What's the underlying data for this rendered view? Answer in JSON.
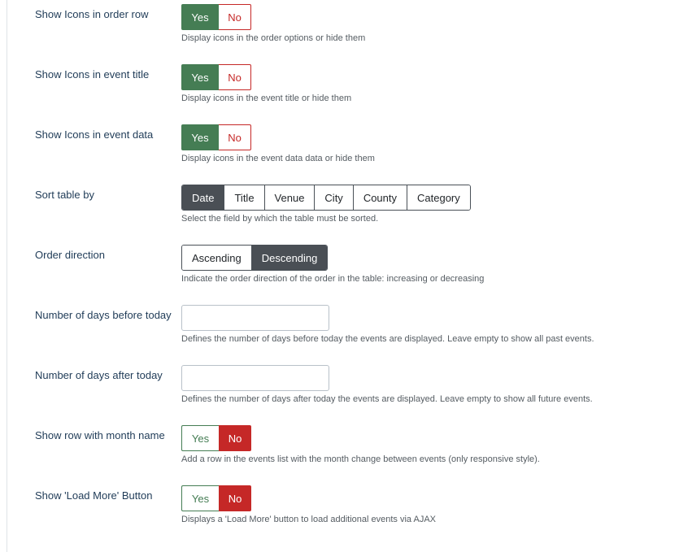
{
  "colors": {
    "yes_green": "#457d54",
    "no_red": "#c52827",
    "active_dark": "#4a4f55",
    "label_blue": "#1f3b57"
  },
  "fields": {
    "icons_order_row": {
      "label": "Show Icons in order row",
      "yes": "Yes",
      "no": "No",
      "selected": "Yes",
      "help": "Display icons in the order options or hide them"
    },
    "icons_event_title": {
      "label": "Show Icons in event title",
      "yes": "Yes",
      "no": "No",
      "selected": "Yes",
      "help": "Display icons in the event title or hide them"
    },
    "icons_event_data": {
      "label": "Show Icons in event data",
      "yes": "Yes",
      "no": "No",
      "selected": "Yes",
      "help": "Display icons in the event data data or hide them"
    },
    "sort_table": {
      "label": "Sort table by",
      "options": [
        "Date",
        "Title",
        "Venue",
        "City",
        "County",
        "Category"
      ],
      "selected": "Date",
      "help": "Select the field by which the table must be sorted."
    },
    "order_direction": {
      "label": "Order direction",
      "options": [
        "Ascending",
        "Descending"
      ],
      "selected": "Descending",
      "help": "Indicate the order direction of the order in the table: increasing or decreasing"
    },
    "days_before": {
      "label": "Number of days before today",
      "value": "",
      "help": "Defines the number of days before today the events are displayed. Leave empty to show all past events."
    },
    "days_after": {
      "label": "Number of days after today",
      "value": "",
      "help": "Defines the number of days after today the events are displayed. Leave empty to show all future events."
    },
    "month_row": {
      "label": "Show row with month name",
      "yes": "Yes",
      "no": "No",
      "selected": "No",
      "help": "Add a row in the events list with the month change between events (only responsive style)."
    },
    "load_more": {
      "label": "Show 'Load More' Button",
      "yes": "Yes",
      "no": "No",
      "selected": "No",
      "help": "Displays a 'Load More' button to load additional events via AJAX"
    }
  }
}
